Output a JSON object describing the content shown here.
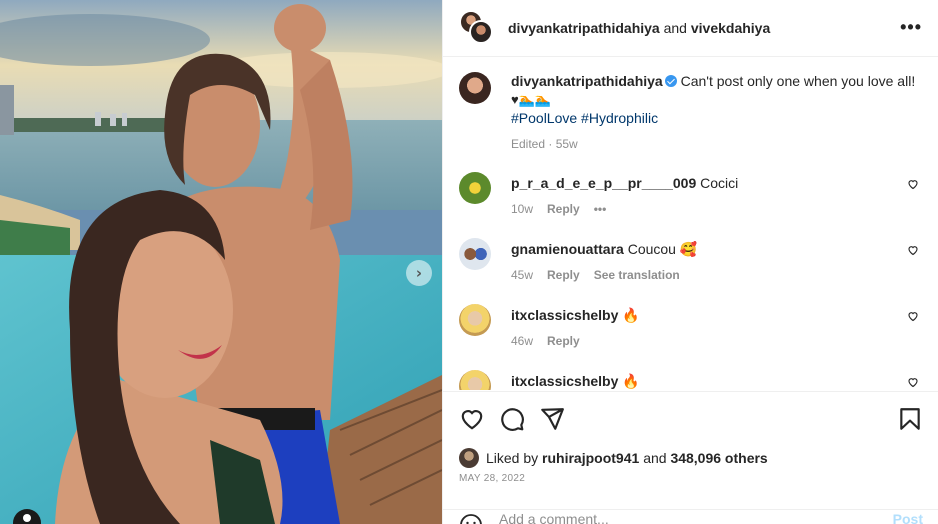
{
  "post": {
    "author_primary": "divyankatripathidahiya",
    "and_text": "and",
    "author_secondary": "vivekdahiya",
    "more_icon": "more-horizontal-icon"
  },
  "caption": {
    "username": "divyankatripathidahiya",
    "text": "Can't post only one when you love all!",
    "emoji_line": "♥🏊🏊",
    "hashtags": "#PoolLove #Hydrophilic",
    "meta": "Edited · 55w"
  },
  "comments": [
    {
      "username": "p_r_a_d_e_e_p__pr____009",
      "text": "Cocici",
      "age": "10w",
      "reply": "Reply",
      "extra": "•••"
    },
    {
      "username": "gnamienouattara",
      "text": "Coucou 🥰",
      "age": "45w",
      "reply": "Reply",
      "extra": "See translation"
    },
    {
      "username": "itxclassicshelby",
      "text": "🔥",
      "age": "46w",
      "reply": "Reply",
      "extra": ""
    },
    {
      "username": "itxclassicshelby",
      "text": "🔥",
      "age": "",
      "reply": "",
      "extra": ""
    }
  ],
  "likes": {
    "prefix": "Liked by",
    "user": "ruhirajpoot941",
    "middle": "and",
    "count": "348,096 others"
  },
  "date": "MAY 28, 2022",
  "add_comment": {
    "placeholder": "Add a comment...",
    "post_label": "Post"
  }
}
